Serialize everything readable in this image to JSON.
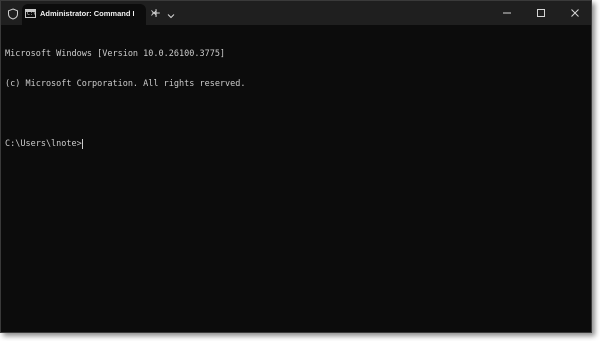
{
  "window": {
    "tab_title": "Administrator: Command Pro",
    "tab_icon_glyph": "C:\\",
    "tab_close_glyph": "×",
    "new_tab_glyph": "+",
    "icons": [
      "shield-icon",
      "terminal-icon",
      "close-icon",
      "plus-icon",
      "chevron-down-icon",
      "minimize-icon",
      "maximize-icon",
      "close-window-icon"
    ]
  },
  "terminal": {
    "lines": [
      "Microsoft Windows [Version 10.0.26100.3775]",
      "(c) Microsoft Corporation. All rights reserved.",
      "",
      "C:\\Users\\lnote>"
    ]
  },
  "colors": {
    "background": "#0c0c0c",
    "titlebar": "#1f1f1f",
    "text": "#cccccc"
  }
}
